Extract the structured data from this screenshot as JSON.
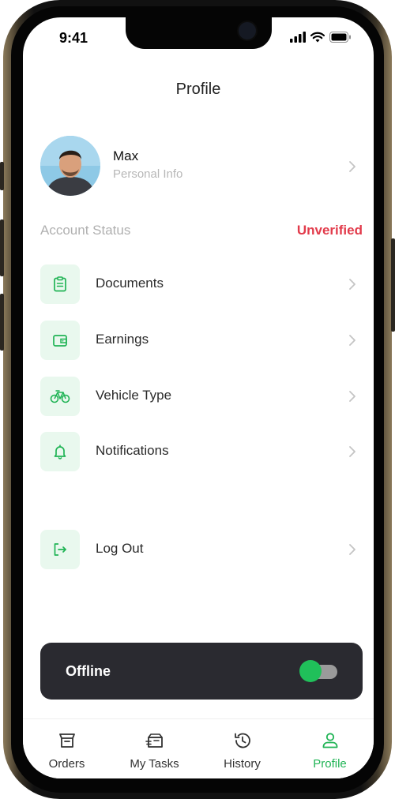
{
  "status_bar": {
    "time": "9:41"
  },
  "header": {
    "title": "Profile"
  },
  "profile": {
    "name": "Max",
    "subtitle": "Personal Info"
  },
  "account": {
    "label": "Account Status",
    "value": "Unverified",
    "value_color": "#e23b4b"
  },
  "menu": [
    {
      "label": "Documents",
      "icon": "clipboard-icon"
    },
    {
      "label": "Earnings",
      "icon": "wallet-icon"
    },
    {
      "label": "Vehicle Type",
      "icon": "bicycle-icon"
    },
    {
      "label": "Notifications",
      "icon": "bell-icon"
    },
    {
      "label": "Log Out",
      "icon": "logout-icon"
    }
  ],
  "availability": {
    "label": "Offline",
    "toggle_on": false
  },
  "tabs": [
    {
      "label": "Orders",
      "icon": "box-icon",
      "active": false
    },
    {
      "label": "My Tasks",
      "icon": "tasks-icon",
      "active": false
    },
    {
      "label": "History",
      "icon": "history-icon",
      "active": false
    },
    {
      "label": "Profile",
      "icon": "person-icon",
      "active": true
    }
  ],
  "colors": {
    "accent": "#20b455",
    "icon_bg": "#e9f8ee",
    "danger": "#e23b4b",
    "dark_card": "#2a2a30"
  }
}
